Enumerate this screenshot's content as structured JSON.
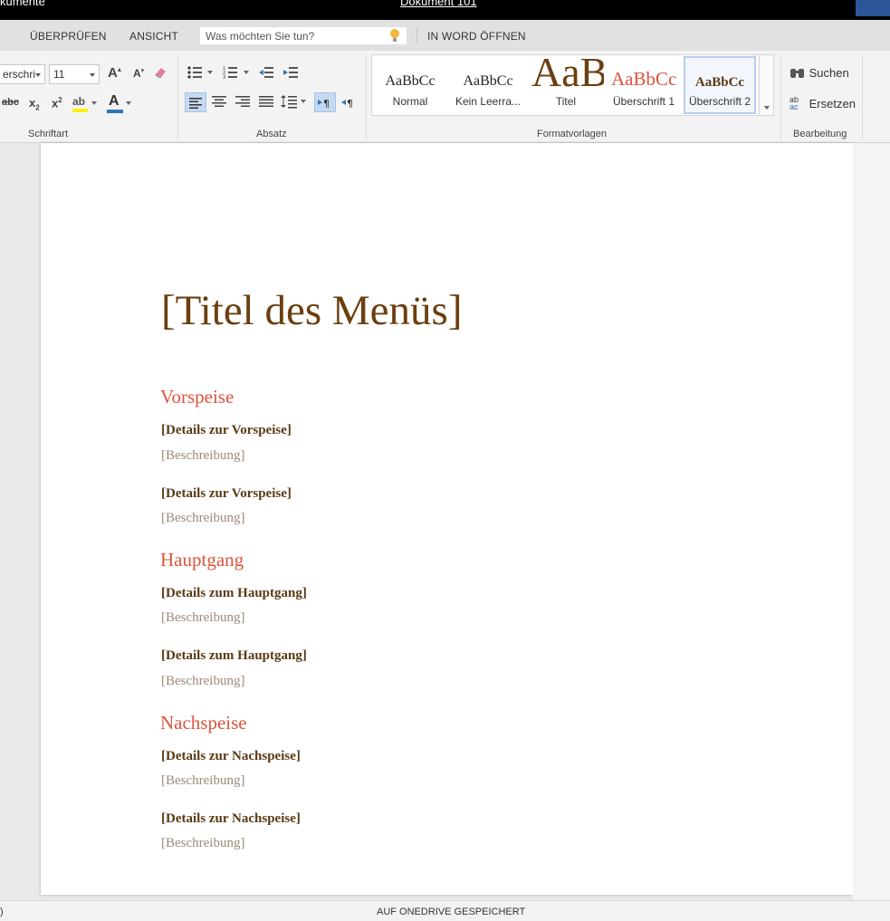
{
  "titlebar": {
    "left_text": "kumente",
    "document_name": "Dokument 101"
  },
  "tabs": {
    "review": "ÜBERPRÜFEN",
    "view": "ANSICHT",
    "tell_me_placeholder": "Was möchten Sie tun?",
    "open_in_word": "IN WORD ÖFFNEN"
  },
  "font": {
    "name": "erschri",
    "size": "11"
  },
  "groups": {
    "font": "Schriftart",
    "paragraph": "Absatz",
    "styles": "Formatvorlagen",
    "editing": "Bearbeitung"
  },
  "buttons": {
    "grow": "A",
    "shrink": "A",
    "strike": "abc",
    "subscript": "x",
    "subscript_mark": "2",
    "superscript": "x",
    "superscript_mark": "2",
    "font_color": "A",
    "highlight": "ab"
  },
  "styles": [
    {
      "sample": "AaBbCc",
      "name": "Normal"
    },
    {
      "sample": "AaBbCc",
      "name": "Kein Leerra..."
    },
    {
      "sample": "AaB",
      "name": "Titel"
    },
    {
      "sample": "AaBbCc",
      "name": "Überschrift 1"
    },
    {
      "sample": "AaBbCc",
      "name": "Überschrift 2"
    }
  ],
  "editing": {
    "find": "Suchen",
    "replace": "Ersetzen",
    "replace_icon_top": "ab",
    "replace_icon_bottom": "ac"
  },
  "document": {
    "title": "[Titel des Menüs]",
    "sections": [
      {
        "heading": "Vorspeise",
        "items": [
          {
            "detail": "[Details zur Vorspeise]",
            "description": "[Beschreibung]"
          },
          {
            "detail": "[Details zur Vorspeise]",
            "description": "[Beschreibung]"
          }
        ]
      },
      {
        "heading": "Hauptgang",
        "items": [
          {
            "detail": "[Details zum Hauptgang]",
            "description": "[Beschreibung]"
          },
          {
            "detail": "[Details zum Hauptgang]",
            "description": "[Beschreibung]"
          }
        ]
      },
      {
        "heading": "Nachspeise",
        "items": [
          {
            "detail": "[Details zur Nachspeise]",
            "description": "[Beschreibung]"
          },
          {
            "detail": "[Details zur Nachspeise]",
            "description": "[Beschreibung]"
          }
        ]
      }
    ]
  },
  "status": {
    "left": ")",
    "saved": "AUF ONEDRIVE GESPEICHERT"
  },
  "colors": {
    "title": "#6b3f10",
    "heading": "#e0533c",
    "detail": "#5a3a14",
    "description": "#9a8a7a",
    "accent": "#2b579a"
  }
}
